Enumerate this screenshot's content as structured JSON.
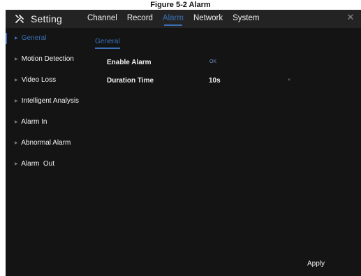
{
  "caption": "Figure 5-2 Alarm",
  "app": {
    "title": "Setting",
    "close_symbol": "✕"
  },
  "tabs": [
    {
      "label": "Channel"
    },
    {
      "label": "Record"
    },
    {
      "label": "Alarm",
      "active": true
    },
    {
      "label": "Network"
    },
    {
      "label": "System"
    }
  ],
  "sidebar": {
    "items": [
      {
        "label": "General",
        "active": true
      },
      {
        "label": "Motion Detection"
      },
      {
        "label": "Video Loss"
      },
      {
        "label": "Intelligent Analysis"
      },
      {
        "label": "Alarm In"
      },
      {
        "label": "Abnormal Alarm"
      },
      {
        "label": "Alarm  Out"
      }
    ]
  },
  "main": {
    "subtab": "General",
    "enable_alarm_label": "Enable Alarm",
    "enable_alarm_value": "OK",
    "duration_label": "Duration Time",
    "duration_value": "10s"
  },
  "footer": {
    "apply_label": "Apply"
  },
  "colors": {
    "accent": "#3a6fb5",
    "background": "#141414",
    "titlebar": "#232323"
  },
  "icons": {
    "app": "tool-icon",
    "close": "close-icon",
    "nav_arrow": "arrow-right-icon",
    "dropdown": "chevron-down-icon"
  }
}
